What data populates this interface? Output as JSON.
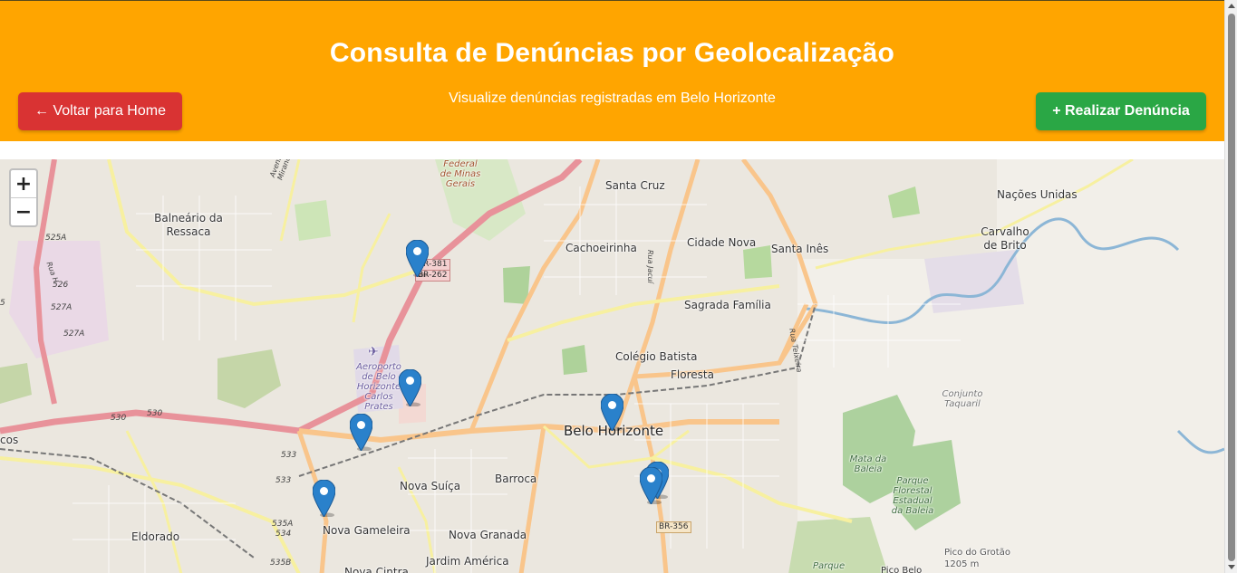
{
  "header": {
    "title": "Consulta de Denúncias por Geolocalização",
    "subtitle": "Visualize denúncias registradas em Belo Horizonte",
    "home_button": "← Voltar para Home",
    "report_button": "+ Realizar Denúncia",
    "background_color": "#ffa500"
  },
  "map": {
    "zoom_in": "+",
    "zoom_out": "−",
    "city_label": "Belo Horizonte",
    "neighborhoods": [
      "Santa Cruz",
      "Nações Unidas",
      "Balneário da Ressaca",
      "Carvalho de Brito",
      "Cachoeirinha",
      "Cidade Nova",
      "Santa Inês",
      "Sagrada Família",
      "Colégio Batista",
      "Floresta",
      "Barroca",
      "Nova Suíça",
      "Nova Gameleira",
      "Eldorado",
      "Nova Granada",
      "Jardim América",
      "Nova Cintra",
      "cos"
    ],
    "poi": {
      "airport": "Aeroporto de Belo Horizonte Carlos Prates",
      "university": "Federal de Minas Gerais",
      "park_mata": "Mata da Baleia",
      "park_state": "Parque Florestal Estadual da Baleia",
      "conjunto": "Conjunto Taquaril",
      "peak": "Pico do Grotão",
      "peak_elev": "1205 m",
      "parque": "Parque",
      "pico_belo": "Pico Belo"
    },
    "roads": {
      "br381": "BR-381",
      "br262": "BR-262",
      "br356": "BR-356",
      "avenida": "Avenida Heráclito Mourão de Miranda",
      "rua_jacui": "Rua Jacuí",
      "rua_h": "Rua H",
      "route_525a": "525A",
      "route_526": "526",
      "route_527a": "527A",
      "route_527a_2": "527A",
      "route_530": "530",
      "route_530_2": "530",
      "route_533": "533",
      "route_533_2": "533",
      "route_535a": "535A",
      "route_534": "534",
      "route_535b": "535B",
      "route_5": "5",
      "rua_right": "Rua Teixeira"
    },
    "marker_count": 8,
    "marker_color": "#2a81cb"
  }
}
